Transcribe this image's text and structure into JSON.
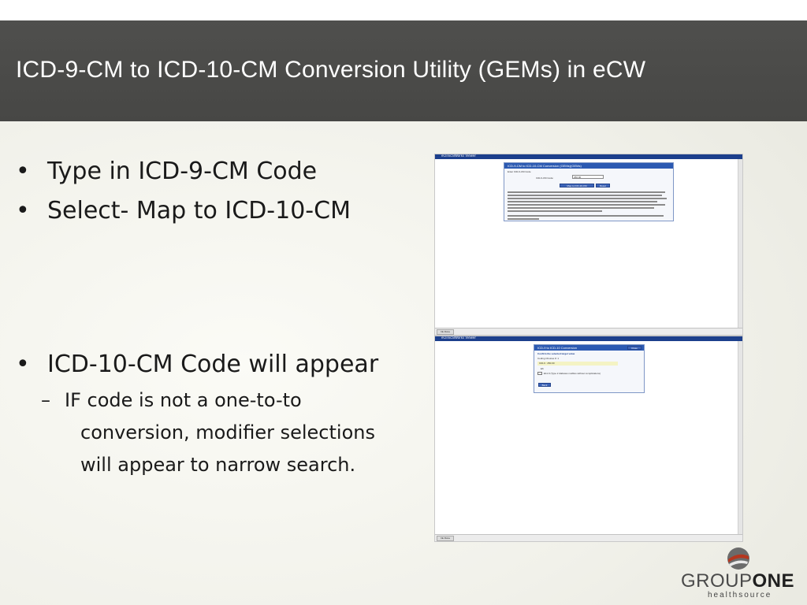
{
  "slide": {
    "title": "ICD-9-CM to ICD-10-CM Conversion Utility (GEMs) in eCW",
    "bullets": [
      {
        "symbol": "•",
        "text": "Type in ICD-9-CM Code"
      },
      {
        "symbol": "•",
        "text": "Select- Map to ICD-10-CM"
      },
      {
        "symbol": "•",
        "text": "ICD-10-CM Code will appear"
      }
    ],
    "sub_bullet": {
      "symbol": "–",
      "lines": [
        "IF code is not a one-to-to",
        "conversion, modifier selections",
        "will appear to narrow search."
      ]
    }
  },
  "screenshots": {
    "top": {
      "window_caption": "eClinicalWorks Viewer",
      "panel_title": "ICD-9-CM to ICD-10-CM Conversion (GEMs)(GEMs)",
      "panel_subtitle": "Enter ICD-9-CM Code",
      "field_label": "ICD-9-CM Code:",
      "field_value": "250.00",
      "map_button": "Map to ICD-10-CM",
      "reset_button": "Reset",
      "status_tab": "Ink Done"
    },
    "bottom": {
      "window_caption": "eClinicalWorks Viewer",
      "panel_title": "ICD-9 to ICD-10 Conversion",
      "close_button": "Close",
      "confirm_label": "Confirm the selected target value",
      "scenario_label": "Coding Choices #: 1",
      "code_line": "ICD-9 : 250.00",
      "option_code": "E6",
      "option_text": "E11.9 (Type 2 diabetes mellitus without complications)",
      "back_button": "Back",
      "status_tab": "Ink Done"
    }
  },
  "logo": {
    "brand_part1": "GROUP",
    "brand_part2": "ONE",
    "tagline": "healthsource"
  },
  "colors": {
    "title_bar": "#4b4b49",
    "title_text": "#ffffff",
    "body_text": "#1a1a1a",
    "window_titlebar": "#1c3f8c",
    "logo_red": "#b5371f",
    "logo_gray": "#6b6b6b"
  }
}
